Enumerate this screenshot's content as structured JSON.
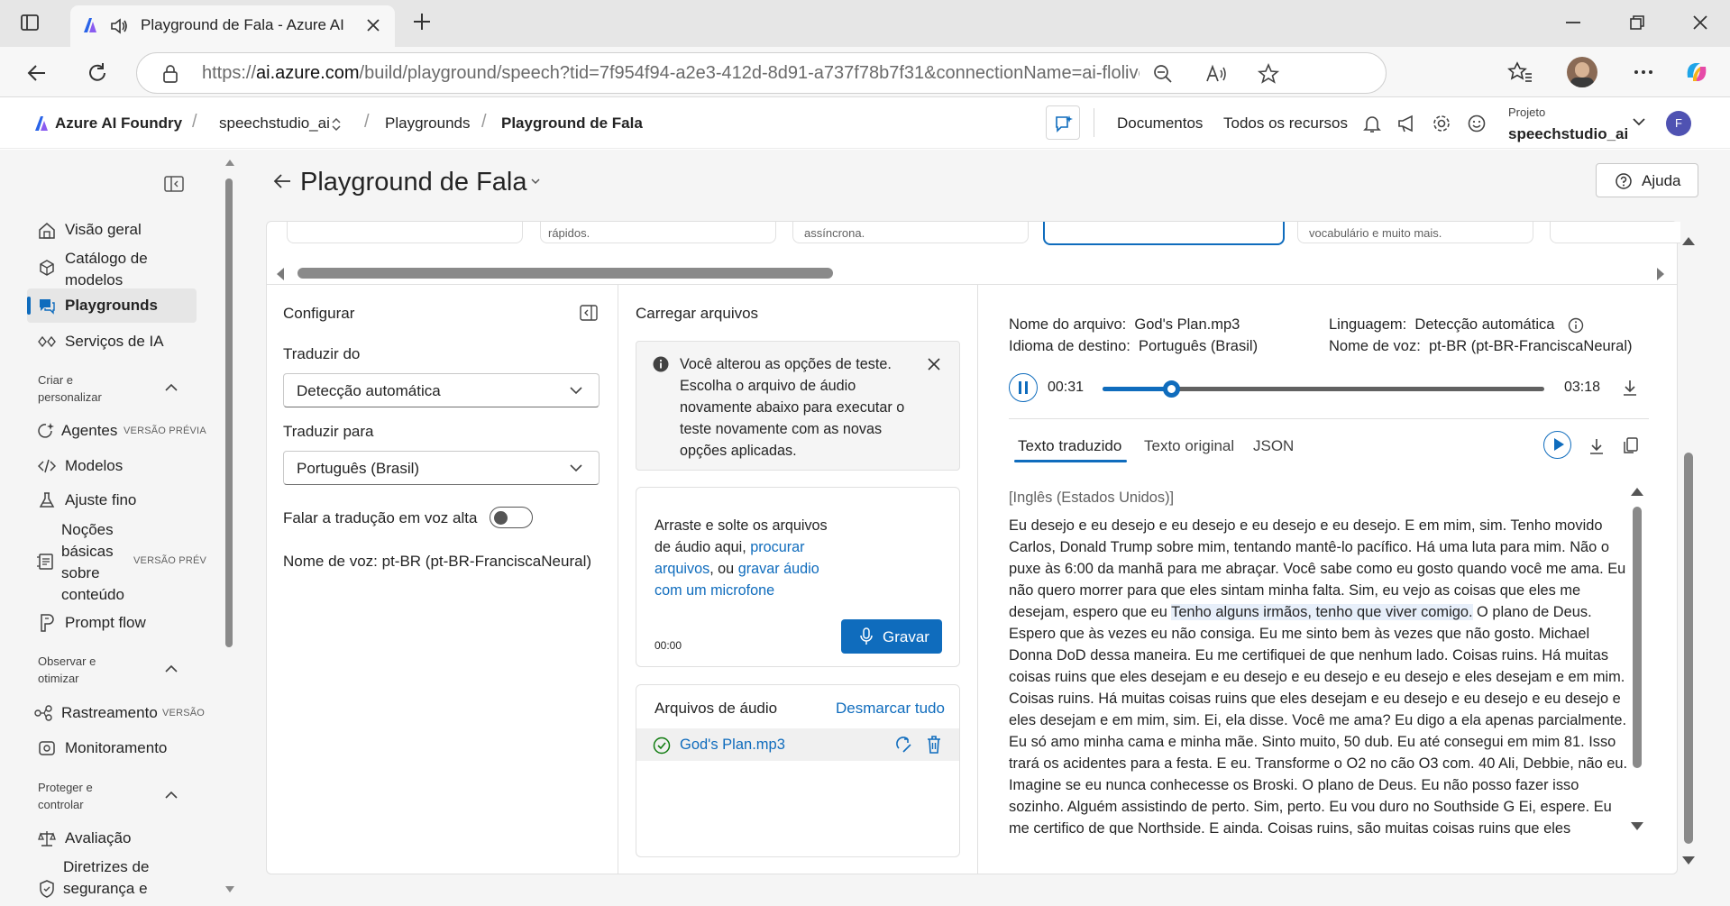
{
  "browser": {
    "tab_title": "Playground de Fala - Azure AI",
    "url_prefix": "https://",
    "url_host": "ai.azure.com",
    "url_path": "/build/playground/speech?tid=7f954f94-a2e3-412d-8d91-a737f78b7f31&connectionName=ai-floliver4011301..."
  },
  "header": {
    "brand": "Azure AI Foundry",
    "breadcrumb": [
      "speechstudio_ai",
      "Playgrounds",
      "Playground de Fala"
    ],
    "links": [
      "Documentos",
      "Todos os recursos"
    ],
    "project_label": "Projeto",
    "project_name": "speechstudio_ai",
    "avatar_initial": "F"
  },
  "sidebar": {
    "items": [
      {
        "label": "Visão geral"
      },
      {
        "label": "Catálogo de modelos"
      },
      {
        "label": "Playgrounds"
      },
      {
        "label": "Serviços de IA"
      }
    ],
    "section_create": "Criar e personalizar",
    "create_items": [
      {
        "label": "Agentes",
        "badge": "VERSÃO PRÉVIA"
      },
      {
        "label": "Modelos"
      },
      {
        "label": "Ajuste fino"
      },
      {
        "label": "Noções básicas sobre conteúdo",
        "badge": "VERSÃO PRÉV"
      },
      {
        "label": "Prompt flow"
      }
    ],
    "section_observe": "Observar e otimizar",
    "observe_items": [
      {
        "label": "Rastreamento",
        "badge": "VERSÃO"
      },
      {
        "label": "Monitoramento"
      }
    ],
    "section_protect": "Proteger e controlar",
    "protect_items": [
      {
        "label": "Avaliação"
      },
      {
        "label": "Diretrizes de segurança e"
      }
    ]
  },
  "page": {
    "title": "Playground de Fala",
    "help_label": "Ajuda",
    "card_snippets": [
      "rápidos.",
      "assíncrona.",
      "vocabulário e muito mais."
    ]
  },
  "config": {
    "title": "Configurar",
    "translate_from_label": "Traduzir do",
    "translate_from_value": "Detecção automática",
    "translate_to_label": "Traduzir para",
    "translate_to_value": "Português (Brasil)",
    "speak_label": "Falar a tradução em voz alta",
    "voice_label": "Nome de voz:",
    "voice_value": "pt-BR (pt-BR-FranciscaNeural)"
  },
  "upload": {
    "title": "Carregar arquivos",
    "notice": "Você alterou as opções de teste. Escolha o arquivo de áudio novamente abaixo para executar o teste novamente com as novas opções aplicadas.",
    "drop_text": "Arraste e solte os arquivos de áudio aqui,",
    "browse_link": "procurar arquivos",
    "or_text": ", ou",
    "record_link": "gravar áudio com um microfone",
    "timer": "00:00",
    "record_button": "Gravar",
    "audio_files_title": "Arquivos de áudio",
    "deselect_all": "Desmarcar tudo",
    "file_name": "God's Plan.mp3"
  },
  "result": {
    "file_label": "Nome do arquivo:",
    "file_value": "God's Plan.mp3",
    "lang_label": "Linguagem:",
    "lang_value": "Detecção automática",
    "target_label": "Idioma de destino:",
    "target_value": "Português (Brasil)",
    "voice_label": "Nome de voz:",
    "voice_value": "pt-BR (pt-BR-FranciscaNeural)",
    "current_time": "00:31",
    "total_time": "03:18",
    "progress": 0.155,
    "tabs": [
      "Texto traduzido",
      "Texto original",
      "JSON"
    ],
    "source_lang": "[Inglês (Estados Unidos)]",
    "text_before": "Eu desejo e eu desejo e eu desejo e eu desejo e eu desejo. E em mim, sim. Tenho movido Carlos, Donald Trump sobre mim, tentando mantê-lo pacífico. Há uma luta para mim. Não o puxe às 6:00 da manhã para me abraçar. Você sabe como eu gosto quando você me ama. Eu não quero morrer para que eles sintam minha falta. Sim, eu vejo as coisas que eles me desejam, espero que eu ",
    "text_highlight": "Tenho alguns irmãos, tenho que viver comigo.",
    "text_after": " O plano de Deus. Espero que às vezes eu não consiga. Eu me sinto bem às vezes que não gosto. Michael Donna DoD dessa maneira. Eu me certifiquei de que nenhum lado. Coisas ruins. Há muitas coisas ruins que eles desejam e eu desejo e eu desejo e eu desejo e eles desejam e em mim. Coisas ruins. Há muitas coisas ruins que eles desejam e eu desejo e eu desejo e eu desejo e eles desejam e em mim, sim. Ei, ela disse. Você me ama? Eu digo a ela apenas parcialmente. Eu só amo minha cama e minha mãe. Sinto muito, 50 dub. Eu até consegui em mim 81. Isso trará os acidentes para a festa. E eu. Transforme o O2 no cão O3 com. 40 Ali, Debbie, não eu. Imagine se eu nunca conhecesse os Broski. O plano de Deus. Eu não posso fazer isso sozinho. Alguém assistindo de perto. Sim, perto. Eu vou duro no Southside G Ei, espere. Eu me certifico de que Northside. E ainda. Coisas ruins, são muitas coisas ruins que eles"
  },
  "colors": {
    "accent": "#0f6cbd",
    "selected_nav": "#e6e6e6"
  }
}
